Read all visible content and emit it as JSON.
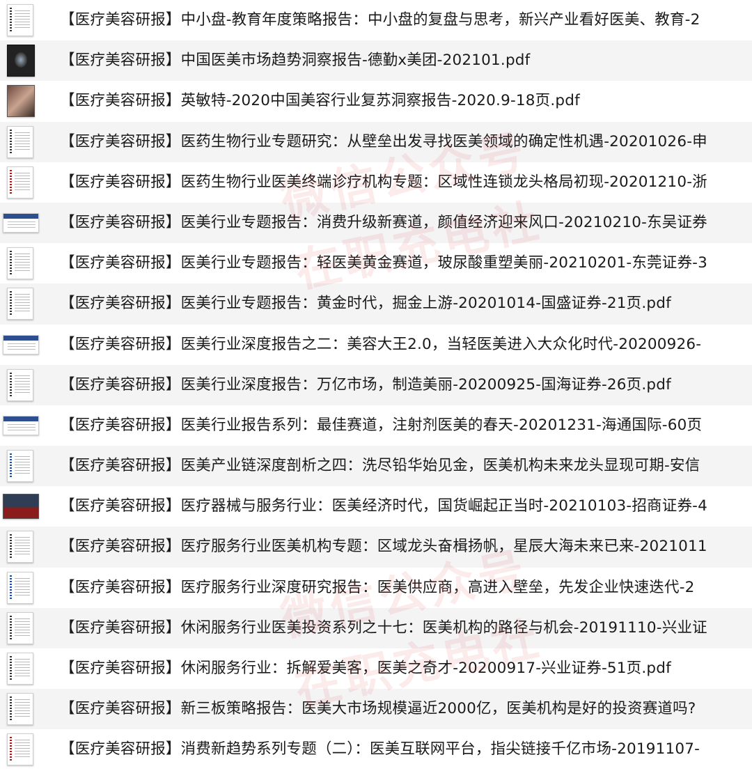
{
  "files": [
    {
      "title": "【医疗美容研报】中小盘-教育年度策略报告：中小盘的复盘与思考，新兴产业看好医美、教育-2",
      "thumb": "doc"
    },
    {
      "title": "【医疗美容研报】中国医美市场趋势洞察报告-德勤x美团-202101.pdf",
      "thumb": "dark"
    },
    {
      "title": "【医疗美容研报】英敏特-2020中国美容行业复苏洞察报告-2020.9-18页.pdf",
      "thumb": "photo"
    },
    {
      "title": "【医疗美容研报】医药生物行业专题研究：从壁垒出发寻找医美领域的确定性机遇-20201026-申",
      "thumb": "doc"
    },
    {
      "title": "【医疗美容研报】医药生物行业医美终端诊疗机构专题：区域性连锁龙头格局初现-20201210-浙",
      "thumb": "doc accent-red"
    },
    {
      "title": "【医疗美容研报】医美行业专题报告：消费升级新赛道，颜值经济迎来风口-20210210-东吴证券",
      "thumb": "wide"
    },
    {
      "title": "【医疗美容研报】医美行业专题报告：轻医美黄金赛道，玻尿酸重塑美丽-20210201-东莞证券-3",
      "thumb": "doc"
    },
    {
      "title": "【医疗美容研报】医美行业专题报告：黄金时代，掘金上游-20201014-国盛证券-21页.pdf",
      "thumb": "doc"
    },
    {
      "title": "【医疗美容研报】医美行业深度报告之二：美容大王2.0，当轻医美进入大众化时代-20200926-",
      "thumb": "wide"
    },
    {
      "title": "【医疗美容研报】医美行业深度报告：万亿市场，制造美丽-20200925-国海证券-26页.pdf",
      "thumb": "doc"
    },
    {
      "title": "【医疗美容研报】医美行业报告系列：最佳赛道，注射剂医美的春天-20201231-海通国际-60页",
      "thumb": "wide"
    },
    {
      "title": "【医疗美容研报】医美产业链深度剖析之四：洗尽铅华始见金，医美机构未来龙头显现可期-安信",
      "thumb": "doc accent-blue"
    },
    {
      "title": "【医疗美容研报】医疗器械与服务行业：医美经济时代，国货崛起正当时-20210103-招商证券-4",
      "thumb": "red"
    },
    {
      "title": "【医疗美容研报】医疗服务行业医美机构专题：区域龙头奋楫扬帆，星辰大海未来已来-2021011",
      "thumb": "doc"
    },
    {
      "title": "【医疗美容研报】医疗服务行业深度研究报告：医美供应商，高进入壁垒，先发企业快速迭代-2",
      "thumb": "doc accent-blue"
    },
    {
      "title": "【医疗美容研报】休闲服务行业医美投资系列之十七：医美机构的路径与机会-20191110-兴业证",
      "thumb": "doc"
    },
    {
      "title": "【医疗美容研报】休闲服务行业：拆解爱美客，医美之奇才-20200917-兴业证券-51页.pdf",
      "thumb": "doc"
    },
    {
      "title": "【医疗美容研报】新三板策略报告：医美大市场规模逼近2000亿，医美机构是好的投资赛道吗?",
      "thumb": "doc"
    },
    {
      "title": "【医疗美容研报】消费新趋势系列专题（二）：医美互联网平台，指尖链接千亿市场-20191107-",
      "thumb": "doc accent-red"
    }
  ],
  "watermarks": [
    "微信公众号",
    "在职充电社"
  ]
}
